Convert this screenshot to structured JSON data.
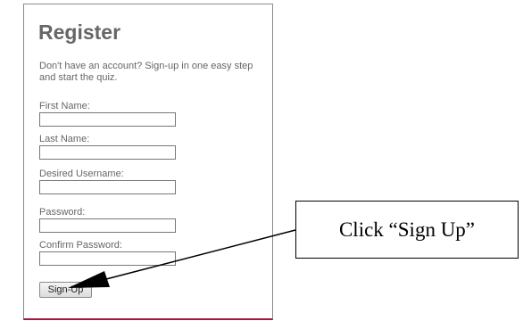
{
  "register_form": {
    "title": "Register",
    "intro": "Don't have an account? Sign-up in one easy step and start the quiz.",
    "fields": [
      {
        "label": "First Name:",
        "value": ""
      },
      {
        "label": "Last Name:",
        "value": ""
      },
      {
        "label": "Desired Username:",
        "value": ""
      },
      {
        "label": "Password:",
        "value": ""
      },
      {
        "label": "Confirm Password:",
        "value": ""
      }
    ],
    "submit_label": "Sign-Up"
  },
  "annotation": {
    "text": "Click “Sign Up”"
  },
  "colors": {
    "text_gray": "#666666",
    "panel_bottom_border": "#9c1b3f"
  }
}
